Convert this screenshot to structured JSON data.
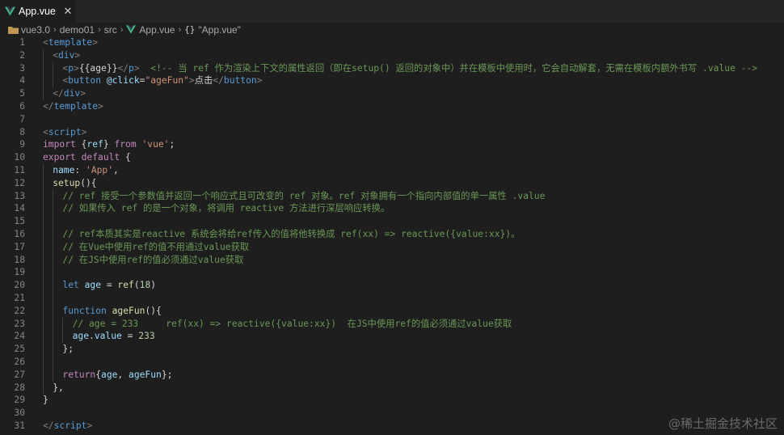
{
  "tab": {
    "title": "App.vue",
    "close_glyph": "✕"
  },
  "breadcrumb": [
    "vue3.0",
    "demo01",
    "src",
    "App.vue",
    "\"App.vue\""
  ],
  "breadcrumb_sep": "›",
  "breadcrumb_braces": "{}",
  "watermark": "@稀土掘金技术社区",
  "editor": {
    "lines": [
      {
        "n": "1",
        "indent": 0,
        "tokens": [
          [
            "tag",
            "<"
          ],
          [
            "name",
            "template"
          ],
          [
            "tag",
            ">"
          ]
        ]
      },
      {
        "n": "2",
        "indent": 1,
        "tokens": [
          [
            "tag",
            "<"
          ],
          [
            "name",
            "div"
          ],
          [
            "tag",
            ">"
          ]
        ]
      },
      {
        "n": "3",
        "indent": 2,
        "tokens": [
          [
            "tag",
            "<"
          ],
          [
            "name",
            "p"
          ],
          [
            "tag",
            ">"
          ],
          [
            "txt",
            "{{age}}"
          ],
          [
            "tag",
            "</"
          ],
          [
            "name",
            "p"
          ],
          [
            "tag",
            ">"
          ],
          [
            "txt",
            "  "
          ],
          [
            "com",
            "<!-- 当 ref 作为渲染上下文的属性返回（即在setup() 返回的对象中）并在模板中使用时，它会自动解套，无需在模板内额外书写 .value -->"
          ]
        ]
      },
      {
        "n": "4",
        "indent": 2,
        "tokens": [
          [
            "tag",
            "<"
          ],
          [
            "name",
            "button"
          ],
          [
            "txt",
            " "
          ],
          [
            "attr",
            "@click"
          ],
          [
            "txt",
            "="
          ],
          [
            "str",
            "\"ageFun\""
          ],
          [
            "tag",
            ">"
          ],
          [
            "txt",
            "点击"
          ],
          [
            "tag",
            "</"
          ],
          [
            "name",
            "button"
          ],
          [
            "tag",
            ">"
          ]
        ]
      },
      {
        "n": "5",
        "indent": 1,
        "tokens": [
          [
            "tag",
            "</"
          ],
          [
            "name",
            "div"
          ],
          [
            "tag",
            ">"
          ]
        ]
      },
      {
        "n": "6",
        "indent": 0,
        "tokens": [
          [
            "tag",
            "</"
          ],
          [
            "name",
            "template"
          ],
          [
            "tag",
            ">"
          ]
        ]
      },
      {
        "n": "7",
        "indent": 0,
        "tokens": []
      },
      {
        "n": "8",
        "indent": 0,
        "tokens": [
          [
            "tag",
            "<"
          ],
          [
            "name",
            "script"
          ],
          [
            "tag",
            ">"
          ]
        ]
      },
      {
        "n": "9",
        "indent": 0,
        "tokens": [
          [
            "kw",
            "import"
          ],
          [
            "txt",
            " {"
          ],
          [
            "var",
            "ref"
          ],
          [
            "txt",
            "} "
          ],
          [
            "kw",
            "from"
          ],
          [
            "txt",
            " "
          ],
          [
            "str",
            "'vue'"
          ],
          [
            "txt",
            ";"
          ]
        ]
      },
      {
        "n": "10",
        "indent": 0,
        "tokens": [
          [
            "kw",
            "export"
          ],
          [
            "txt",
            " "
          ],
          [
            "kw",
            "default"
          ],
          [
            "txt",
            " {"
          ]
        ]
      },
      {
        "n": "11",
        "indent": 1,
        "tokens": [
          [
            "var",
            "name"
          ],
          [
            "txt",
            ": "
          ],
          [
            "str",
            "'App'"
          ],
          [
            "txt",
            ","
          ]
        ]
      },
      {
        "n": "12",
        "indent": 1,
        "tokens": [
          [
            "fn",
            "setup"
          ],
          [
            "txt",
            "(){"
          ]
        ]
      },
      {
        "n": "13",
        "indent": 2,
        "tokens": [
          [
            "com",
            "// ref 接受一个参数值并返回一个响应式且可改变的 ref 对象。ref 对象拥有一个指向内部值的单一属性 .value"
          ]
        ]
      },
      {
        "n": "14",
        "indent": 2,
        "tokens": [
          [
            "com",
            "// 如果传入 ref 的是一个对象，将调用 reactive 方法进行深层响应转换。"
          ]
        ]
      },
      {
        "n": "15",
        "indent": 2,
        "tokens": []
      },
      {
        "n": "16",
        "indent": 2,
        "tokens": [
          [
            "com",
            "// ref本质其实是reactive 系统会将给ref传入的值将他转换成 ref(xx) => reactive({value:xx})。"
          ]
        ]
      },
      {
        "n": "17",
        "indent": 2,
        "tokens": [
          [
            "com",
            "// 在Vue中使用ref的值不用通过value获取"
          ]
        ]
      },
      {
        "n": "18",
        "indent": 2,
        "tokens": [
          [
            "com",
            "// 在JS中使用ref的值必须通过value获取"
          ]
        ]
      },
      {
        "n": "19",
        "indent": 2,
        "tokens": []
      },
      {
        "n": "20",
        "indent": 2,
        "tokens": [
          [
            "decl",
            "let"
          ],
          [
            "txt",
            " "
          ],
          [
            "var",
            "age"
          ],
          [
            "txt",
            " = "
          ],
          [
            "fn",
            "ref"
          ],
          [
            "txt",
            "("
          ],
          [
            "num",
            "18"
          ],
          [
            "txt",
            ")"
          ]
        ]
      },
      {
        "n": "21",
        "indent": 2,
        "tokens": []
      },
      {
        "n": "22",
        "indent": 2,
        "tokens": [
          [
            "decl",
            "function"
          ],
          [
            "txt",
            " "
          ],
          [
            "fn",
            "ageFun"
          ],
          [
            "txt",
            "(){"
          ]
        ]
      },
      {
        "n": "23",
        "indent": 3,
        "tokens": [
          [
            "com",
            "// age = 233     ref(xx) => reactive({value:xx})  在JS中使用ref的值必须通过value获取"
          ]
        ]
      },
      {
        "n": "24",
        "indent": 3,
        "tokens": [
          [
            "var",
            "age"
          ],
          [
            "txt",
            "."
          ],
          [
            "var",
            "value"
          ],
          [
            "txt",
            " = "
          ],
          [
            "num",
            "233"
          ]
        ]
      },
      {
        "n": "25",
        "indent": 2,
        "tokens": [
          [
            "txt",
            "};"
          ]
        ]
      },
      {
        "n": "26",
        "indent": 2,
        "tokens": []
      },
      {
        "n": "27",
        "indent": 2,
        "tokens": [
          [
            "kw",
            "return"
          ],
          [
            "txt",
            "{"
          ],
          [
            "var",
            "age"
          ],
          [
            "txt",
            ", "
          ],
          [
            "var",
            "ageFun"
          ],
          [
            "txt",
            "};"
          ]
        ]
      },
      {
        "n": "28",
        "indent": 1,
        "tokens": [
          [
            "txt",
            "},"
          ]
        ]
      },
      {
        "n": "29",
        "indent": 0,
        "tokens": [
          [
            "txt",
            "}"
          ]
        ]
      },
      {
        "n": "30",
        "indent": 0,
        "tokens": []
      },
      {
        "n": "31",
        "indent": 0,
        "tokens": [
          [
            "tag",
            "</"
          ],
          [
            "name",
            "script"
          ],
          [
            "tag",
            ">"
          ]
        ]
      }
    ]
  },
  "colors": {
    "editor_bg": "#1e1e1e",
    "tabbar_bg": "#252526",
    "vue_green": "#41b883",
    "vue_dark": "#35495e",
    "comment": "#6a9955",
    "keyword": "#c586c0",
    "string": "#ce9178"
  }
}
